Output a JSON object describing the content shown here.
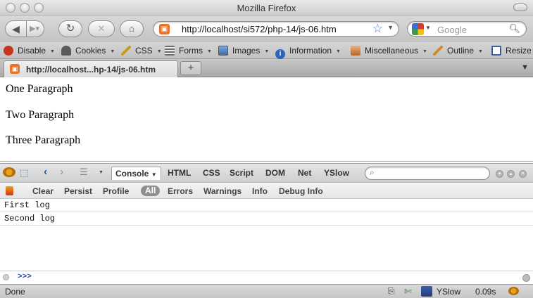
{
  "window": {
    "title": "Mozilla Firefox"
  },
  "nav": {
    "url": "http://localhost/si572/php-14/js-06.htm",
    "search_placeholder": "Google"
  },
  "webdev": {
    "items": [
      {
        "label": "Disable",
        "icon": "disable-icon",
        "color": "#c8331f"
      },
      {
        "label": "Cookies",
        "icon": "cookie-person-icon",
        "color": "#5a5a5a"
      },
      {
        "label": "CSS",
        "icon": "pencil-icon",
        "color": "#c89a20"
      },
      {
        "label": "Forms",
        "icon": "form-icon",
        "color": "#6b6b6b"
      },
      {
        "label": "Images",
        "icon": "image-icon",
        "color": "#3b6fb0"
      },
      {
        "label": "Information",
        "icon": "info-icon",
        "color": "#2e63b8"
      },
      {
        "label": "Miscellaneous",
        "icon": "tools-icon",
        "color": "#b3652b"
      },
      {
        "label": "Outline",
        "icon": "outline-pencil-icon",
        "color": "#d98a1e"
      },
      {
        "label": "Resize",
        "icon": "resize-icon",
        "color": "#3a5fa5"
      }
    ]
  },
  "tabs": [
    {
      "title": "http://localhost...hp-14/js-06.htm"
    }
  ],
  "page": {
    "paragraphs": [
      "One Paragraph",
      "Two Paragraph",
      "Three Paragraph"
    ]
  },
  "firebug": {
    "panels": [
      "Console",
      "HTML",
      "CSS",
      "Script",
      "DOM",
      "Net",
      "YSlow"
    ],
    "active_panel": "Console",
    "console_buttons": [
      "Clear",
      "Persist",
      "Profile"
    ],
    "filters": [
      "All",
      "Errors",
      "Warnings",
      "Info",
      "Debug Info"
    ],
    "active_filter": "All",
    "logs": [
      "First log",
      "Second log"
    ],
    "prompt": ">>>"
  },
  "status": {
    "text": "Done",
    "yslow_label": "YSlow",
    "load_time": "0.09s"
  }
}
